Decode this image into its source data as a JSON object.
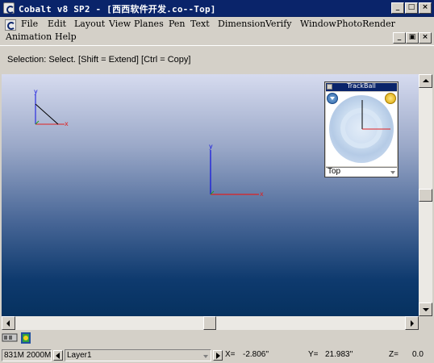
{
  "window": {
    "title": "Cobalt v8 SP2 - [西西软件开发.co--Top]"
  },
  "caption_buttons": {
    "minimize": "_",
    "maximize": "□",
    "close": "×"
  },
  "mdi_buttons": {
    "minimize": "_",
    "restore": "▣",
    "close": "×"
  },
  "menu": {
    "items": [
      "File",
      "Edit",
      "Layout",
      "View",
      "Planes",
      "Pen",
      "Text",
      "Dimension",
      "Verify",
      "Window",
      "PhotoRender",
      "Animation",
      "Help"
    ]
  },
  "prompt": {
    "text": "Selection: Select. [Shift = Extend] [Ctrl = Copy]"
  },
  "axes": {
    "x_label": "x",
    "y_label": "y",
    "x_color": "#e02020",
    "y_color": "#1010e0",
    "z_color": "#20a020"
  },
  "trackball": {
    "title": "TrackBall",
    "view": "Top"
  },
  "status": {
    "memory": "831M 2000M",
    "layer": "Layer1",
    "x_label": "X=",
    "x_value": "-2.806''",
    "y_label": "Y=",
    "y_value": "21.983''",
    "z_label": "Z=",
    "z_value": "0.0"
  },
  "colors": {
    "titlebar": "#0a246a",
    "chrome": "#d4d0c8",
    "viewport_top": "#d6dbef",
    "viewport_bottom": "#06315f"
  }
}
